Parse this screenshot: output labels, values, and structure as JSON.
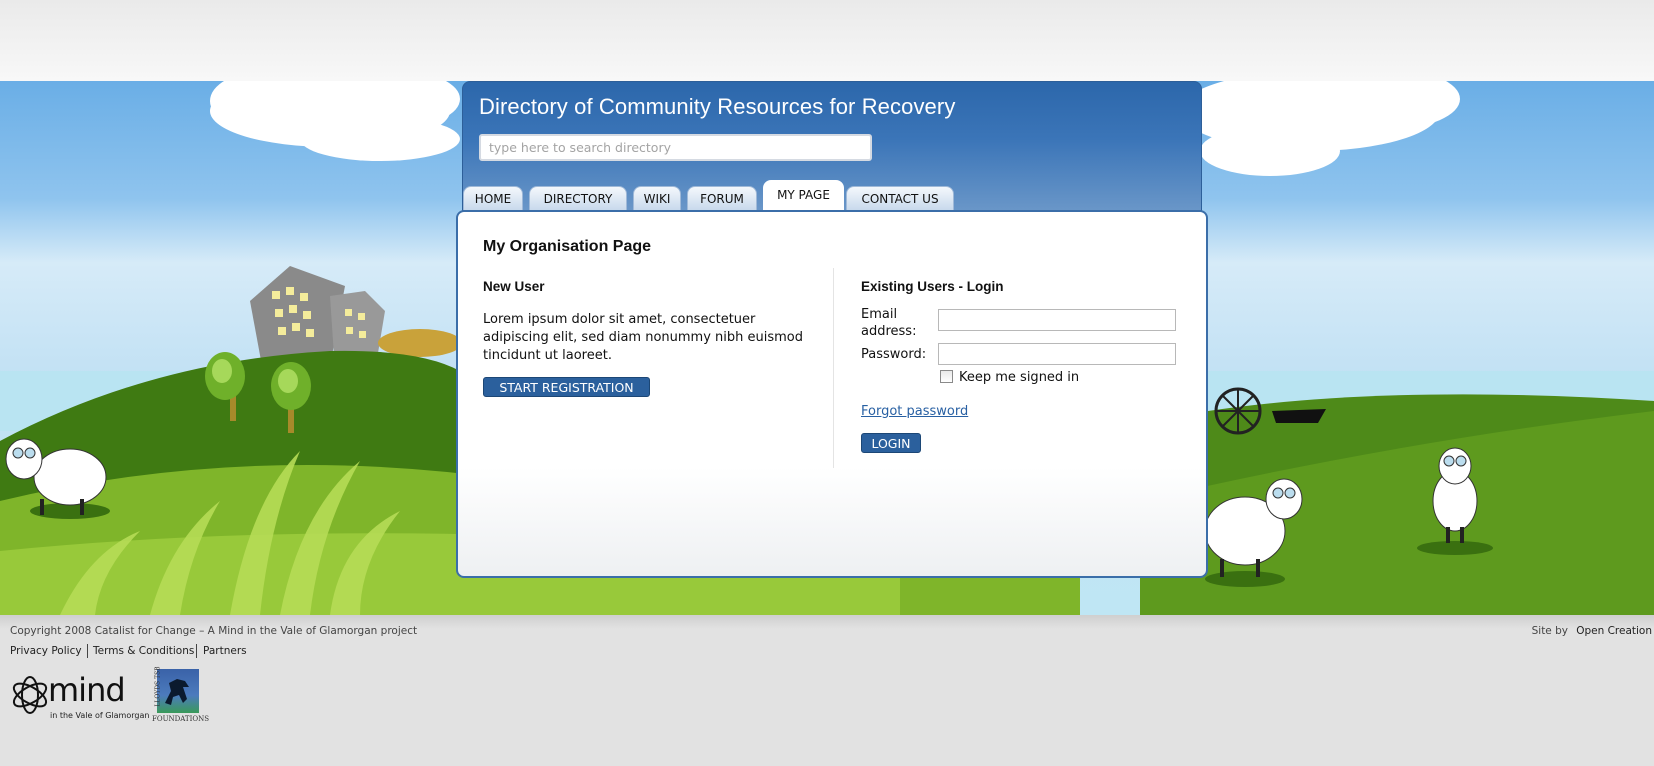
{
  "site": {
    "title": "Directory of Community Resources for Recovery",
    "search_placeholder": "type here to search directory"
  },
  "nav": {
    "tabs": [
      {
        "label": "HOME"
      },
      {
        "label": "DIRECTORY"
      },
      {
        "label": "WIKI"
      },
      {
        "label": "FORUM"
      },
      {
        "label": "MY PAGE",
        "active": true
      },
      {
        "label": "CONTACT US"
      }
    ]
  },
  "main": {
    "page_title": "My Organisation Page",
    "new_user": {
      "heading": "New User",
      "text": "Lorem ipsum dolor sit amet, consectetuer adipiscing elit, sed diam nonummy nibh euismod tincidunt ut laoreet.",
      "button": "START REGISTRATION"
    },
    "login": {
      "heading": "Existing Users - Login",
      "email_label": "Email address:",
      "password_label": "Password:",
      "keep_signed_in": "Keep me signed in",
      "forgot": "Forgot password",
      "button": "LOGIN"
    }
  },
  "footer": {
    "copyright": "Copyright 2008 Catalist for Change – A Mind in the Vale of Glamorgan project",
    "links": [
      "Privacy Policy",
      "Terms & Conditions",
      "Partners"
    ],
    "site_by_prefix": "Site by",
    "site_by_link": "Open Creation",
    "mind_logo_text": "mind",
    "mind_logo_sub": "in the Vale of Glamorgan",
    "lloyds_logo_text": "LLOYDS TSB",
    "lloyds_logo_sub": "FOUNDATIONS"
  },
  "colors": {
    "header_blue": "#2c67ab",
    "button_blue": "#2b609d",
    "link_blue": "#2860a3",
    "grass_green": "#5e9a1e"
  }
}
